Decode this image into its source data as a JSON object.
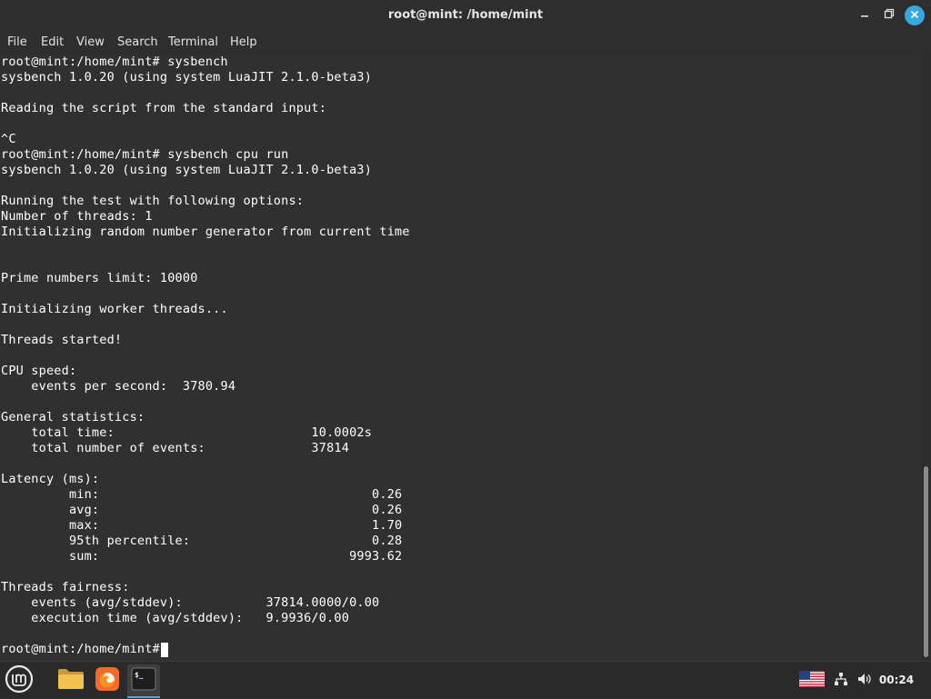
{
  "window": {
    "title": "root@mint: /home/mint",
    "minimize_icon": "minimize-icon",
    "maximize_icon": "restore-icon",
    "close_icon": "close-icon"
  },
  "menu": {
    "items": [
      "File",
      "Edit",
      "View",
      "Search",
      "Terminal",
      "Help"
    ]
  },
  "terminal": {
    "lines": [
      "root@mint:/home/mint# sysbench",
      "sysbench 1.0.20 (using system LuaJIT 2.1.0-beta3)",
      "",
      "Reading the script from the standard input:",
      "",
      "^C",
      "root@mint:/home/mint# sysbench cpu run",
      "sysbench 1.0.20 (using system LuaJIT 2.1.0-beta3)",
      "",
      "Running the test with following options:",
      "Number of threads: 1",
      "Initializing random number generator from current time",
      "",
      "",
      "Prime numbers limit: 10000",
      "",
      "Initializing worker threads...",
      "",
      "Threads started!",
      "",
      "CPU speed:",
      "    events per second:  3780.94",
      "",
      "General statistics:",
      "    total time:                          10.0002s",
      "    total number of events:              37814",
      "",
      "Latency (ms):",
      "         min:                                    0.26",
      "         avg:                                    0.26",
      "         max:                                    1.70",
      "         95th percentile:                        0.28",
      "         sum:                                 9993.62",
      "",
      "Threads fairness:",
      "    events (avg/stddev):           37814.0000/0.00",
      "    execution time (avg/stddev):   9.9936/0.00",
      "",
      "root@mint:/home/mint# "
    ]
  },
  "taskbar": {
    "menu_icon": "linux-mint-menu-icon",
    "apps": [
      {
        "icon": "files-folder-icon"
      },
      {
        "icon": "firefox-icon"
      },
      {
        "icon": "terminal-icon",
        "glyph": "$_",
        "active": true
      }
    ],
    "tray": {
      "keyboard_layout_icon": "us-flag-icon",
      "network_icon": "network-icon",
      "volume_icon": "volume-icon",
      "clock": "00:24"
    }
  },
  "colors": {
    "terminal_bg": "#303030",
    "terminal_fg": "#ffffff",
    "accent": "#35a8e0"
  }
}
